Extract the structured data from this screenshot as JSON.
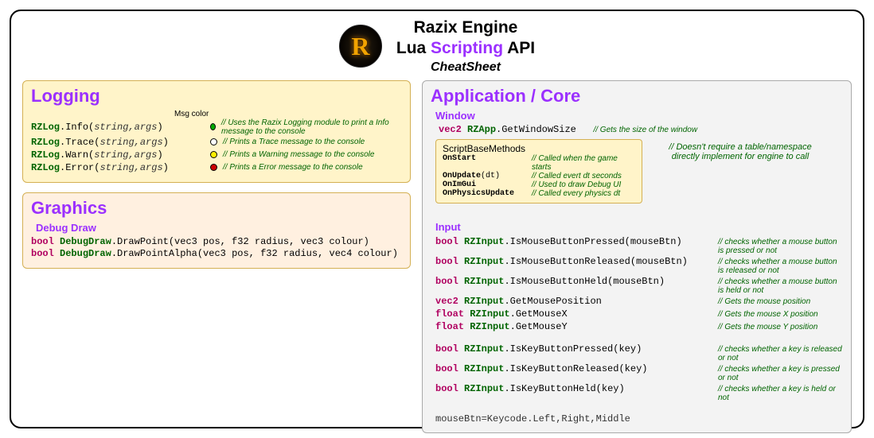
{
  "title": {
    "line1": "Razix Engine",
    "line2_pre": "Lua ",
    "line2_accent": "Scripting",
    "line2_post": " API",
    "line3": "CheatSheet",
    "logo_letter": "R"
  },
  "logging": {
    "title": "Logging",
    "msg_color_label": "Msg color",
    "rows": [
      {
        "ns": "RZLog",
        "method": "Info",
        "args": "string,args",
        "dot": "#00aa00",
        "cmt": "// Uses the Razix Logging module to print a Info message to the console"
      },
      {
        "ns": "RZLog",
        "method": "Trace",
        "args": "string,args",
        "dot": "#ffffff",
        "cmt": "// Prints a Trace message to the console"
      },
      {
        "ns": "RZLog",
        "method": "Warn",
        "args": "string,args",
        "dot": "#ffee00",
        "cmt": "// Prints a Warning message to the console"
      },
      {
        "ns": "RZLog",
        "method": "Error",
        "args": "string,args",
        "dot": "#cc0000",
        "cmt": "// Prints a Error message to the console"
      }
    ]
  },
  "graphics": {
    "title": "Graphics",
    "sub": "Debug Draw",
    "lines": [
      {
        "ret": "bool",
        "ns": "DebugDraw",
        "method": "DrawPoint",
        "args": "vec3 pos, f32 radius, vec3 colour"
      },
      {
        "ret": "bool",
        "ns": "DebugDraw",
        "method": "DrawPointAlpha",
        "args": "vec3 pos, f32 radius, vec4 colour"
      }
    ]
  },
  "app": {
    "title": "Application / Core",
    "window": {
      "sub": "Window",
      "line": {
        "ret": "vec2",
        "ns": "RZApp",
        "method": "GetWindowSize",
        "cmt": "// Gets the size of the window"
      }
    },
    "script": {
      "legend": "ScriptBaseMethods",
      "rows": [
        {
          "name": "OnStart",
          "arg": "",
          "cmt": "// Called when the game starts"
        },
        {
          "name": "OnUpdate",
          "arg": "(dt)",
          "cmt": "// Called evert dt seconds"
        },
        {
          "name": "OnImGui",
          "arg": "",
          "cmt": "// Used to draw Debug UI"
        },
        {
          "name": "OnPhysicsUpdate",
          "arg": "",
          "cmt": "//  Called every physics dt"
        }
      ],
      "note": "// Doesn't require a table/namespace directly implement for engine to call"
    },
    "input": {
      "sub": "Input",
      "mouse": [
        {
          "ret": "bool",
          "ns": "RZInput",
          "method": "IsMouseButtonPressed",
          "args": "mouseBtn",
          "cmt": "// checks whether a mouse button is pressed or not"
        },
        {
          "ret": "bool",
          "ns": "RZInput",
          "method": "IsMouseButtonReleased",
          "args": "mouseBtn",
          "cmt": "// checks whether a mouse button is released or not"
        },
        {
          "ret": "bool",
          "ns": "RZInput",
          "method": "IsMouseButtonHeld",
          "args": "mouseBtn",
          "cmt": "// checks whether a mouse button is held or not"
        },
        {
          "ret": "vec2",
          "ns": "RZInput",
          "method": "GetMousePosition",
          "args": "",
          "cmt": "// Gets the mouse position"
        },
        {
          "ret": "float",
          "ns": "RZInput",
          "method": "GetMouseX",
          "args": "",
          "cmt": "// Gets the mouse X position"
        },
        {
          "ret": "float",
          "ns": "RZInput",
          "method": "GetMouseY",
          "args": "",
          "cmt": "// Gets the mouse Y position"
        }
      ],
      "key": [
        {
          "ret": "bool",
          "ns": "RZInput",
          "method": "IsKeyButtonPressed",
          "args": "key",
          "cmt": "// checks whether a key is released or not"
        },
        {
          "ret": "bool",
          "ns": "RZInput",
          "method": "IsKeyButtonReleased",
          "args": "key",
          "cmt": "// checks whether a key is pressed or not"
        },
        {
          "ret": "bool",
          "ns": "RZInput",
          "method": "IsKeyButtonHeld",
          "args": "key",
          "cmt": "// checks whether a key is held or not"
        }
      ],
      "note": "mouseBtn=Keycode.Left,Right,Middle"
    }
  }
}
